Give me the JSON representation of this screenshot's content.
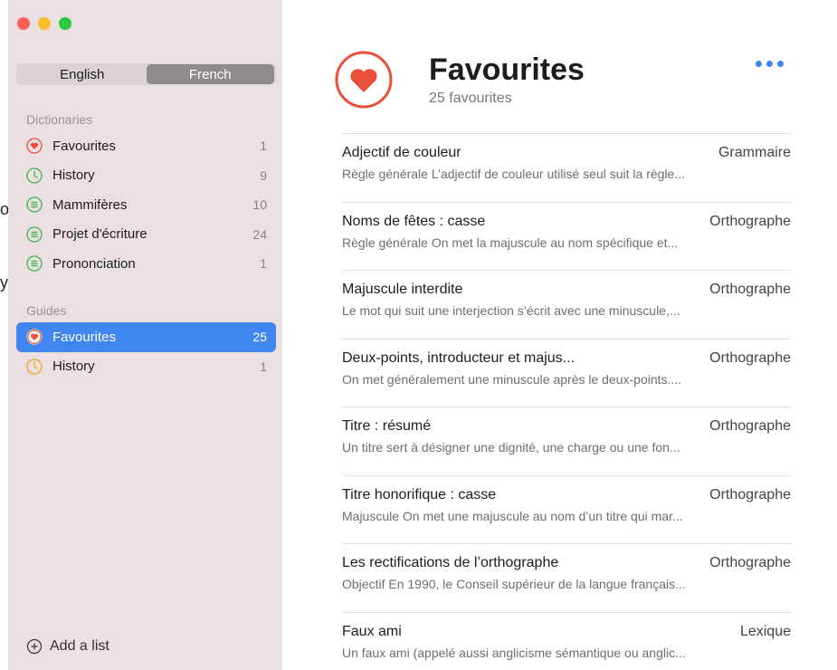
{
  "bleed": {
    "char1": "o",
    "char2": "y"
  },
  "sidebar": {
    "language_segments": [
      {
        "label": "English",
        "active": false
      },
      {
        "label": "French",
        "active": true
      }
    ],
    "dictionaries_header": "Dictionaries",
    "dictionaries": [
      {
        "icon": "heart-icon",
        "label": "Favourites",
        "count": "1",
        "color": "#e8503a"
      },
      {
        "icon": "clock-icon",
        "label": "History",
        "count": "9",
        "color": "#39b54a"
      },
      {
        "icon": "list-icon",
        "label": "Mammifères",
        "count": "10",
        "color": "#39b54a"
      },
      {
        "icon": "list-icon",
        "label": "Projet d'écriture",
        "count": "24",
        "color": "#39b54a"
      },
      {
        "icon": "list-icon",
        "label": "Prononciation",
        "count": "1",
        "color": "#39b54a"
      }
    ],
    "guides_header": "Guides",
    "guides": [
      {
        "icon": "heart-icon",
        "label": "Favourites",
        "count": "25",
        "color": "#e8503a",
        "selected": true
      },
      {
        "icon": "clock-icon",
        "label": "History",
        "count": "1",
        "color": "#f5a623",
        "selected": false
      }
    ],
    "add_list_label": "Add a list"
  },
  "main": {
    "title": "Favourites",
    "subtitle": "25 favourites",
    "accent_color": "#e8503a",
    "rows": [
      {
        "title": "Adjectif de couleur",
        "category": "Grammaire",
        "snippet": "Règle générale L’adjectif de couleur utilisé seul suit la règle..."
      },
      {
        "title": "Noms de fêtes : casse",
        "category": "Orthographe",
        "snippet": "Règle générale On met la majuscule au nom spécifique et..."
      },
      {
        "title": "Majuscule interdite",
        "category": "Orthographe",
        "snippet": "Le mot qui suit une interjection s’écrit avec une minuscule,..."
      },
      {
        "title": "Deux-points, introducteur et majus...",
        "category": "Orthographe",
        "snippet": "On met généralement une minuscule après le deux-points...."
      },
      {
        "title": "Titre : résumé",
        "category": "Orthographe",
        "snippet": "Un titre sert à désigner une dignité, une charge ou une fon..."
      },
      {
        "title": "Titre honorifique : casse",
        "category": "Orthographe",
        "snippet": "Majuscule On met une majuscule au nom d’un titre qui mar..."
      },
      {
        "title": "Les rectifications de l’orthographe",
        "category": "Orthographe",
        "snippet": "Objectif En 1990, le Conseil supérieur de la langue français..."
      },
      {
        "title": "Faux ami",
        "category": "Lexique",
        "snippet": "Un faux ami (appelé aussi anglicisme sémantique ou anglic..."
      }
    ]
  }
}
